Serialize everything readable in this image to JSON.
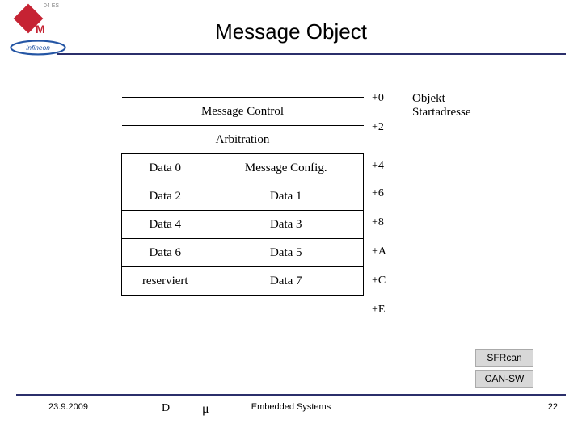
{
  "header": {
    "title": "Message Object",
    "cue": "04 ES"
  },
  "logo": {
    "letter": "M",
    "name": "Infineon"
  },
  "diagram": {
    "start_addr_label": "Objekt Startadresse",
    "rows": [
      {
        "cells": [
          "Message Control"
        ],
        "span": 2,
        "offset": "+0"
      },
      {
        "cells": [
          "Arbitration"
        ],
        "span": 2,
        "offset": "+2",
        "offset_alt": "+4",
        "tall": true
      },
      {
        "cells": [
          "Data 0",
          "Message Config."
        ],
        "offset": "+6"
      },
      {
        "cells": [
          "Data 2",
          "Data 1"
        ],
        "offset": "+8"
      },
      {
        "cells": [
          "Data 4",
          "Data 3"
        ],
        "offset": "+A"
      },
      {
        "cells": [
          "Data 6",
          "Data 5"
        ],
        "offset": "+C"
      },
      {
        "cells": [
          "reserviert",
          "Data 7"
        ],
        "offset": "+E"
      }
    ]
  },
  "offsets": [
    "+0",
    "+2",
    "+4",
    "+6",
    "+8",
    "+A",
    "+C",
    "+E"
  ],
  "links": {
    "sfrcan": "SFRcan",
    "cansw": "CAN-SW"
  },
  "footer": {
    "date": "23.9.2009",
    "d": "D",
    "mu": "μ",
    "center": "Embedded Systems",
    "page": "22"
  },
  "colors": {
    "rule": "#2b2f6b",
    "accent_red": "#c62333"
  }
}
